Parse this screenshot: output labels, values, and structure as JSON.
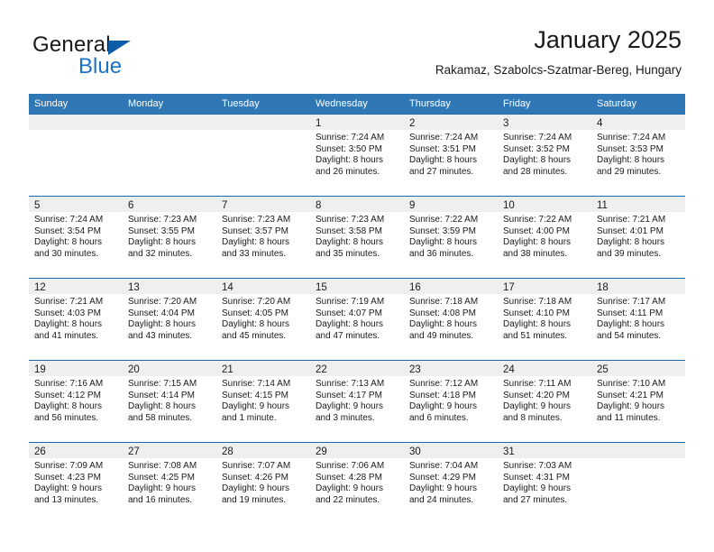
{
  "brand": {
    "name_part1": "General",
    "name_part2": "Blue",
    "accent_color": "#1c72c4",
    "triangle_color": "#0d5ca8"
  },
  "header": {
    "title": "January 2025",
    "subtitle": "Rakamaz, Szabolcs-Szatmar-Bereg, Hungary"
  },
  "calendar": {
    "header_bg": "#2f77b5",
    "row_divider": "#1d69ae",
    "day_band_bg": "#efefef",
    "weekdays": [
      "Sunday",
      "Monday",
      "Tuesday",
      "Wednesday",
      "Thursday",
      "Friday",
      "Saturday"
    ],
    "weeks": [
      [
        {
          "day": "",
          "empty": true,
          "sunrise": "",
          "sunset": "",
          "daylight1": "",
          "daylight2": ""
        },
        {
          "day": "",
          "empty": true,
          "sunrise": "",
          "sunset": "",
          "daylight1": "",
          "daylight2": ""
        },
        {
          "day": "",
          "empty": true,
          "sunrise": "",
          "sunset": "",
          "daylight1": "",
          "daylight2": ""
        },
        {
          "day": "1",
          "sunrise": "Sunrise: 7:24 AM",
          "sunset": "Sunset: 3:50 PM",
          "daylight1": "Daylight: 8 hours",
          "daylight2": "and 26 minutes."
        },
        {
          "day": "2",
          "sunrise": "Sunrise: 7:24 AM",
          "sunset": "Sunset: 3:51 PM",
          "daylight1": "Daylight: 8 hours",
          "daylight2": "and 27 minutes."
        },
        {
          "day": "3",
          "sunrise": "Sunrise: 7:24 AM",
          "sunset": "Sunset: 3:52 PM",
          "daylight1": "Daylight: 8 hours",
          "daylight2": "and 28 minutes."
        },
        {
          "day": "4",
          "sunrise": "Sunrise: 7:24 AM",
          "sunset": "Sunset: 3:53 PM",
          "daylight1": "Daylight: 8 hours",
          "daylight2": "and 29 minutes."
        }
      ],
      [
        {
          "day": "5",
          "sunrise": "Sunrise: 7:24 AM",
          "sunset": "Sunset: 3:54 PM",
          "daylight1": "Daylight: 8 hours",
          "daylight2": "and 30 minutes."
        },
        {
          "day": "6",
          "sunrise": "Sunrise: 7:23 AM",
          "sunset": "Sunset: 3:55 PM",
          "daylight1": "Daylight: 8 hours",
          "daylight2": "and 32 minutes."
        },
        {
          "day": "7",
          "sunrise": "Sunrise: 7:23 AM",
          "sunset": "Sunset: 3:57 PM",
          "daylight1": "Daylight: 8 hours",
          "daylight2": "and 33 minutes."
        },
        {
          "day": "8",
          "sunrise": "Sunrise: 7:23 AM",
          "sunset": "Sunset: 3:58 PM",
          "daylight1": "Daylight: 8 hours",
          "daylight2": "and 35 minutes."
        },
        {
          "day": "9",
          "sunrise": "Sunrise: 7:22 AM",
          "sunset": "Sunset: 3:59 PM",
          "daylight1": "Daylight: 8 hours",
          "daylight2": "and 36 minutes."
        },
        {
          "day": "10",
          "sunrise": "Sunrise: 7:22 AM",
          "sunset": "Sunset: 4:00 PM",
          "daylight1": "Daylight: 8 hours",
          "daylight2": "and 38 minutes."
        },
        {
          "day": "11",
          "sunrise": "Sunrise: 7:21 AM",
          "sunset": "Sunset: 4:01 PM",
          "daylight1": "Daylight: 8 hours",
          "daylight2": "and 39 minutes."
        }
      ],
      [
        {
          "day": "12",
          "sunrise": "Sunrise: 7:21 AM",
          "sunset": "Sunset: 4:03 PM",
          "daylight1": "Daylight: 8 hours",
          "daylight2": "and 41 minutes."
        },
        {
          "day": "13",
          "sunrise": "Sunrise: 7:20 AM",
          "sunset": "Sunset: 4:04 PM",
          "daylight1": "Daylight: 8 hours",
          "daylight2": "and 43 minutes."
        },
        {
          "day": "14",
          "sunrise": "Sunrise: 7:20 AM",
          "sunset": "Sunset: 4:05 PM",
          "daylight1": "Daylight: 8 hours",
          "daylight2": "and 45 minutes."
        },
        {
          "day": "15",
          "sunrise": "Sunrise: 7:19 AM",
          "sunset": "Sunset: 4:07 PM",
          "daylight1": "Daylight: 8 hours",
          "daylight2": "and 47 minutes."
        },
        {
          "day": "16",
          "sunrise": "Sunrise: 7:18 AM",
          "sunset": "Sunset: 4:08 PM",
          "daylight1": "Daylight: 8 hours",
          "daylight2": "and 49 minutes."
        },
        {
          "day": "17",
          "sunrise": "Sunrise: 7:18 AM",
          "sunset": "Sunset: 4:10 PM",
          "daylight1": "Daylight: 8 hours",
          "daylight2": "and 51 minutes."
        },
        {
          "day": "18",
          "sunrise": "Sunrise: 7:17 AM",
          "sunset": "Sunset: 4:11 PM",
          "daylight1": "Daylight: 8 hours",
          "daylight2": "and 54 minutes."
        }
      ],
      [
        {
          "day": "19",
          "sunrise": "Sunrise: 7:16 AM",
          "sunset": "Sunset: 4:12 PM",
          "daylight1": "Daylight: 8 hours",
          "daylight2": "and 56 minutes."
        },
        {
          "day": "20",
          "sunrise": "Sunrise: 7:15 AM",
          "sunset": "Sunset: 4:14 PM",
          "daylight1": "Daylight: 8 hours",
          "daylight2": "and 58 minutes."
        },
        {
          "day": "21",
          "sunrise": "Sunrise: 7:14 AM",
          "sunset": "Sunset: 4:15 PM",
          "daylight1": "Daylight: 9 hours",
          "daylight2": "and 1 minute."
        },
        {
          "day": "22",
          "sunrise": "Sunrise: 7:13 AM",
          "sunset": "Sunset: 4:17 PM",
          "daylight1": "Daylight: 9 hours",
          "daylight2": "and 3 minutes."
        },
        {
          "day": "23",
          "sunrise": "Sunrise: 7:12 AM",
          "sunset": "Sunset: 4:18 PM",
          "daylight1": "Daylight: 9 hours",
          "daylight2": "and 6 minutes."
        },
        {
          "day": "24",
          "sunrise": "Sunrise: 7:11 AM",
          "sunset": "Sunset: 4:20 PM",
          "daylight1": "Daylight: 9 hours",
          "daylight2": "and 8 minutes."
        },
        {
          "day": "25",
          "sunrise": "Sunrise: 7:10 AM",
          "sunset": "Sunset: 4:21 PM",
          "daylight1": "Daylight: 9 hours",
          "daylight2": "and 11 minutes."
        }
      ],
      [
        {
          "day": "26",
          "sunrise": "Sunrise: 7:09 AM",
          "sunset": "Sunset: 4:23 PM",
          "daylight1": "Daylight: 9 hours",
          "daylight2": "and 13 minutes."
        },
        {
          "day": "27",
          "sunrise": "Sunrise: 7:08 AM",
          "sunset": "Sunset: 4:25 PM",
          "daylight1": "Daylight: 9 hours",
          "daylight2": "and 16 minutes."
        },
        {
          "day": "28",
          "sunrise": "Sunrise: 7:07 AM",
          "sunset": "Sunset: 4:26 PM",
          "daylight1": "Daylight: 9 hours",
          "daylight2": "and 19 minutes."
        },
        {
          "day": "29",
          "sunrise": "Sunrise: 7:06 AM",
          "sunset": "Sunset: 4:28 PM",
          "daylight1": "Daylight: 9 hours",
          "daylight2": "and 22 minutes."
        },
        {
          "day": "30",
          "sunrise": "Sunrise: 7:04 AM",
          "sunset": "Sunset: 4:29 PM",
          "daylight1": "Daylight: 9 hours",
          "daylight2": "and 24 minutes."
        },
        {
          "day": "31",
          "sunrise": "Sunrise: 7:03 AM",
          "sunset": "Sunset: 4:31 PM",
          "daylight1": "Daylight: 9 hours",
          "daylight2": "and 27 minutes."
        },
        {
          "day": "",
          "empty": true,
          "sunrise": "",
          "sunset": "",
          "daylight1": "",
          "daylight2": ""
        }
      ]
    ]
  }
}
